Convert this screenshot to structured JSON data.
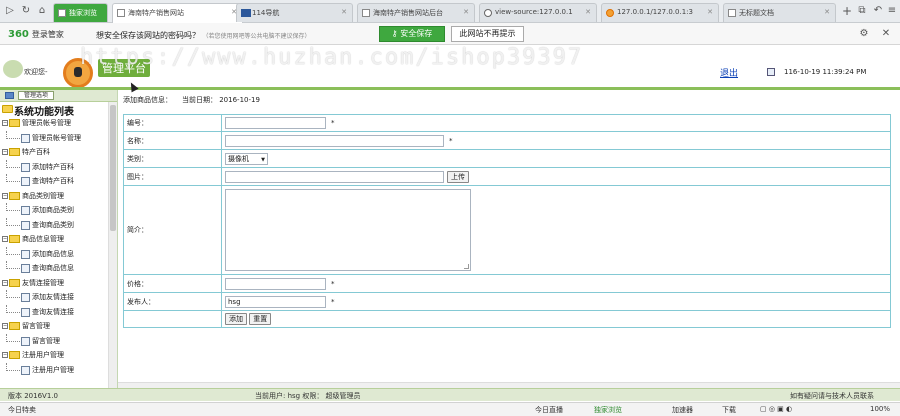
{
  "browser": {
    "tabs": [
      {
        "label": "独家浏览"
      },
      {
        "label": "海南特产销售网站"
      },
      {
        "label": "114导航"
      },
      {
        "label": "海南特产销售网站后台"
      },
      {
        "label": "view-source:127.0.0.1"
      },
      {
        "label": "127.0.0.1/127.0.0.1:3"
      },
      {
        "label": "无标题文档"
      }
    ],
    "new_tab": "+"
  },
  "infobar": {
    "brand": "360",
    "brand_sub": "登录管家",
    "prompt": "想安全保存该网站的密码吗？",
    "hint": "（若您使用网吧等公共电脑不建议保存）",
    "save_button": "安全保存",
    "never_button": "此网站不再提示"
  },
  "watermark": "https://www.huzhan.com/ishop39397",
  "header": {
    "welcome": "欢迎您-",
    "brand_title": "管理平台",
    "logout": "退出",
    "datetime": "116-10-19  11:39:24 PM"
  },
  "sidebar": {
    "head_button": "管理选项",
    "title": "系统功能列表",
    "groups": [
      {
        "label": "管理员帐号管理",
        "items": [
          "管理员帐号管理"
        ]
      },
      {
        "label": "特产百科",
        "items": [
          "添加特产百科",
          "查询特产百科"
        ]
      },
      {
        "label": "商品类别管理",
        "items": [
          "添加商品类别",
          "查询商品类别"
        ]
      },
      {
        "label": "商品信息管理",
        "items": [
          "添加商品信息",
          "查询商品信息"
        ]
      },
      {
        "label": "友情连接管理",
        "items": [
          "添加友情连接",
          "查询友情连接"
        ]
      },
      {
        "label": "留言管理",
        "items": [
          "留言管理"
        ]
      },
      {
        "label": "注册用户管理",
        "items": [
          "注册用户管理"
        ]
      }
    ]
  },
  "main": {
    "crumb": "添加商品信息：",
    "crumb_date": "当前日期：  2016-10-19",
    "fields": {
      "code_label": "编号：",
      "name_label": "名称：",
      "category_label": "类别：",
      "category_value": "摄像机",
      "image_label": "图片：",
      "upload_button": "上传",
      "intro_label": "简介：",
      "price_label": "价格：",
      "publisher_label": "发布人：",
      "publisher_value": "hsg",
      "required_mark": "*"
    },
    "buttons": {
      "add": "添加",
      "reset": "重置"
    }
  },
  "footer": {
    "version": "版本 2016V1.0",
    "current_user": "当前用户: hsg  权限：  超级管理员",
    "right": "如有疑问请与技术人员联系"
  },
  "statusbar": {
    "items": [
      "今日特卖",
      "今日直播",
      "独家浏览",
      "加速器",
      "下载",
      "",
      "100%"
    ]
  }
}
